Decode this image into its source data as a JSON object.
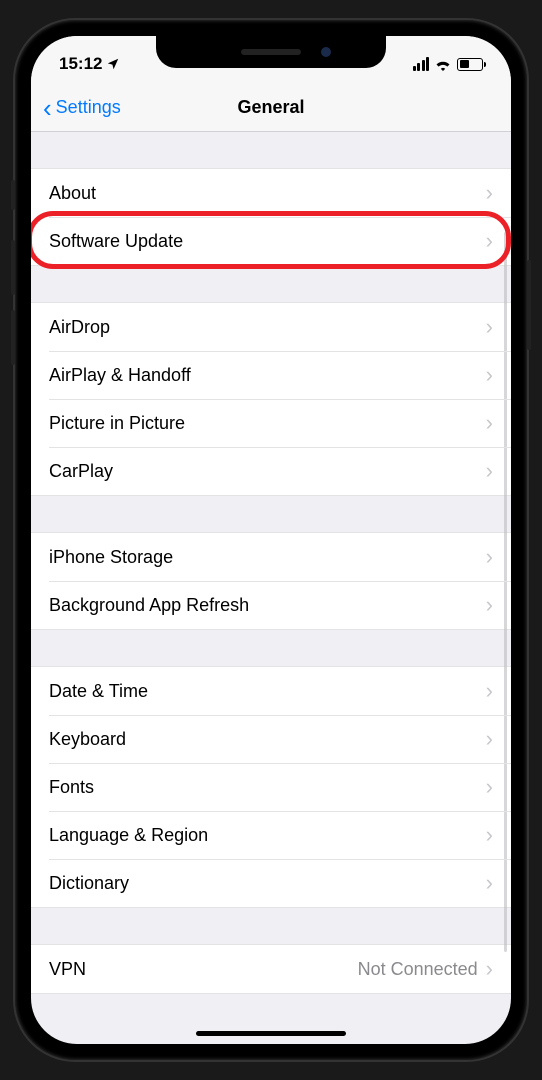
{
  "status": {
    "time": "15:12",
    "battery_pct": 45
  },
  "nav": {
    "back_label": "Settings",
    "title": "General"
  },
  "groups": [
    {
      "rows": [
        {
          "key": "about",
          "label": "About"
        },
        {
          "key": "software-update",
          "label": "Software Update",
          "highlight": true
        }
      ]
    },
    {
      "rows": [
        {
          "key": "airdrop",
          "label": "AirDrop"
        },
        {
          "key": "airplay-handoff",
          "label": "AirPlay & Handoff"
        },
        {
          "key": "picture-in-picture",
          "label": "Picture in Picture"
        },
        {
          "key": "carplay",
          "label": "CarPlay"
        }
      ]
    },
    {
      "rows": [
        {
          "key": "iphone-storage",
          "label": "iPhone Storage"
        },
        {
          "key": "background-app-refresh",
          "label": "Background App Refresh"
        }
      ]
    },
    {
      "rows": [
        {
          "key": "date-time",
          "label": "Date & Time"
        },
        {
          "key": "keyboard",
          "label": "Keyboard"
        },
        {
          "key": "fonts",
          "label": "Fonts"
        },
        {
          "key": "language-region",
          "label": "Language & Region"
        },
        {
          "key": "dictionary",
          "label": "Dictionary"
        }
      ]
    },
    {
      "rows": [
        {
          "key": "vpn",
          "label": "VPN",
          "value": "Not Connected"
        }
      ]
    }
  ],
  "colors": {
    "accent": "#007aff",
    "highlight": "#ec2027"
  }
}
